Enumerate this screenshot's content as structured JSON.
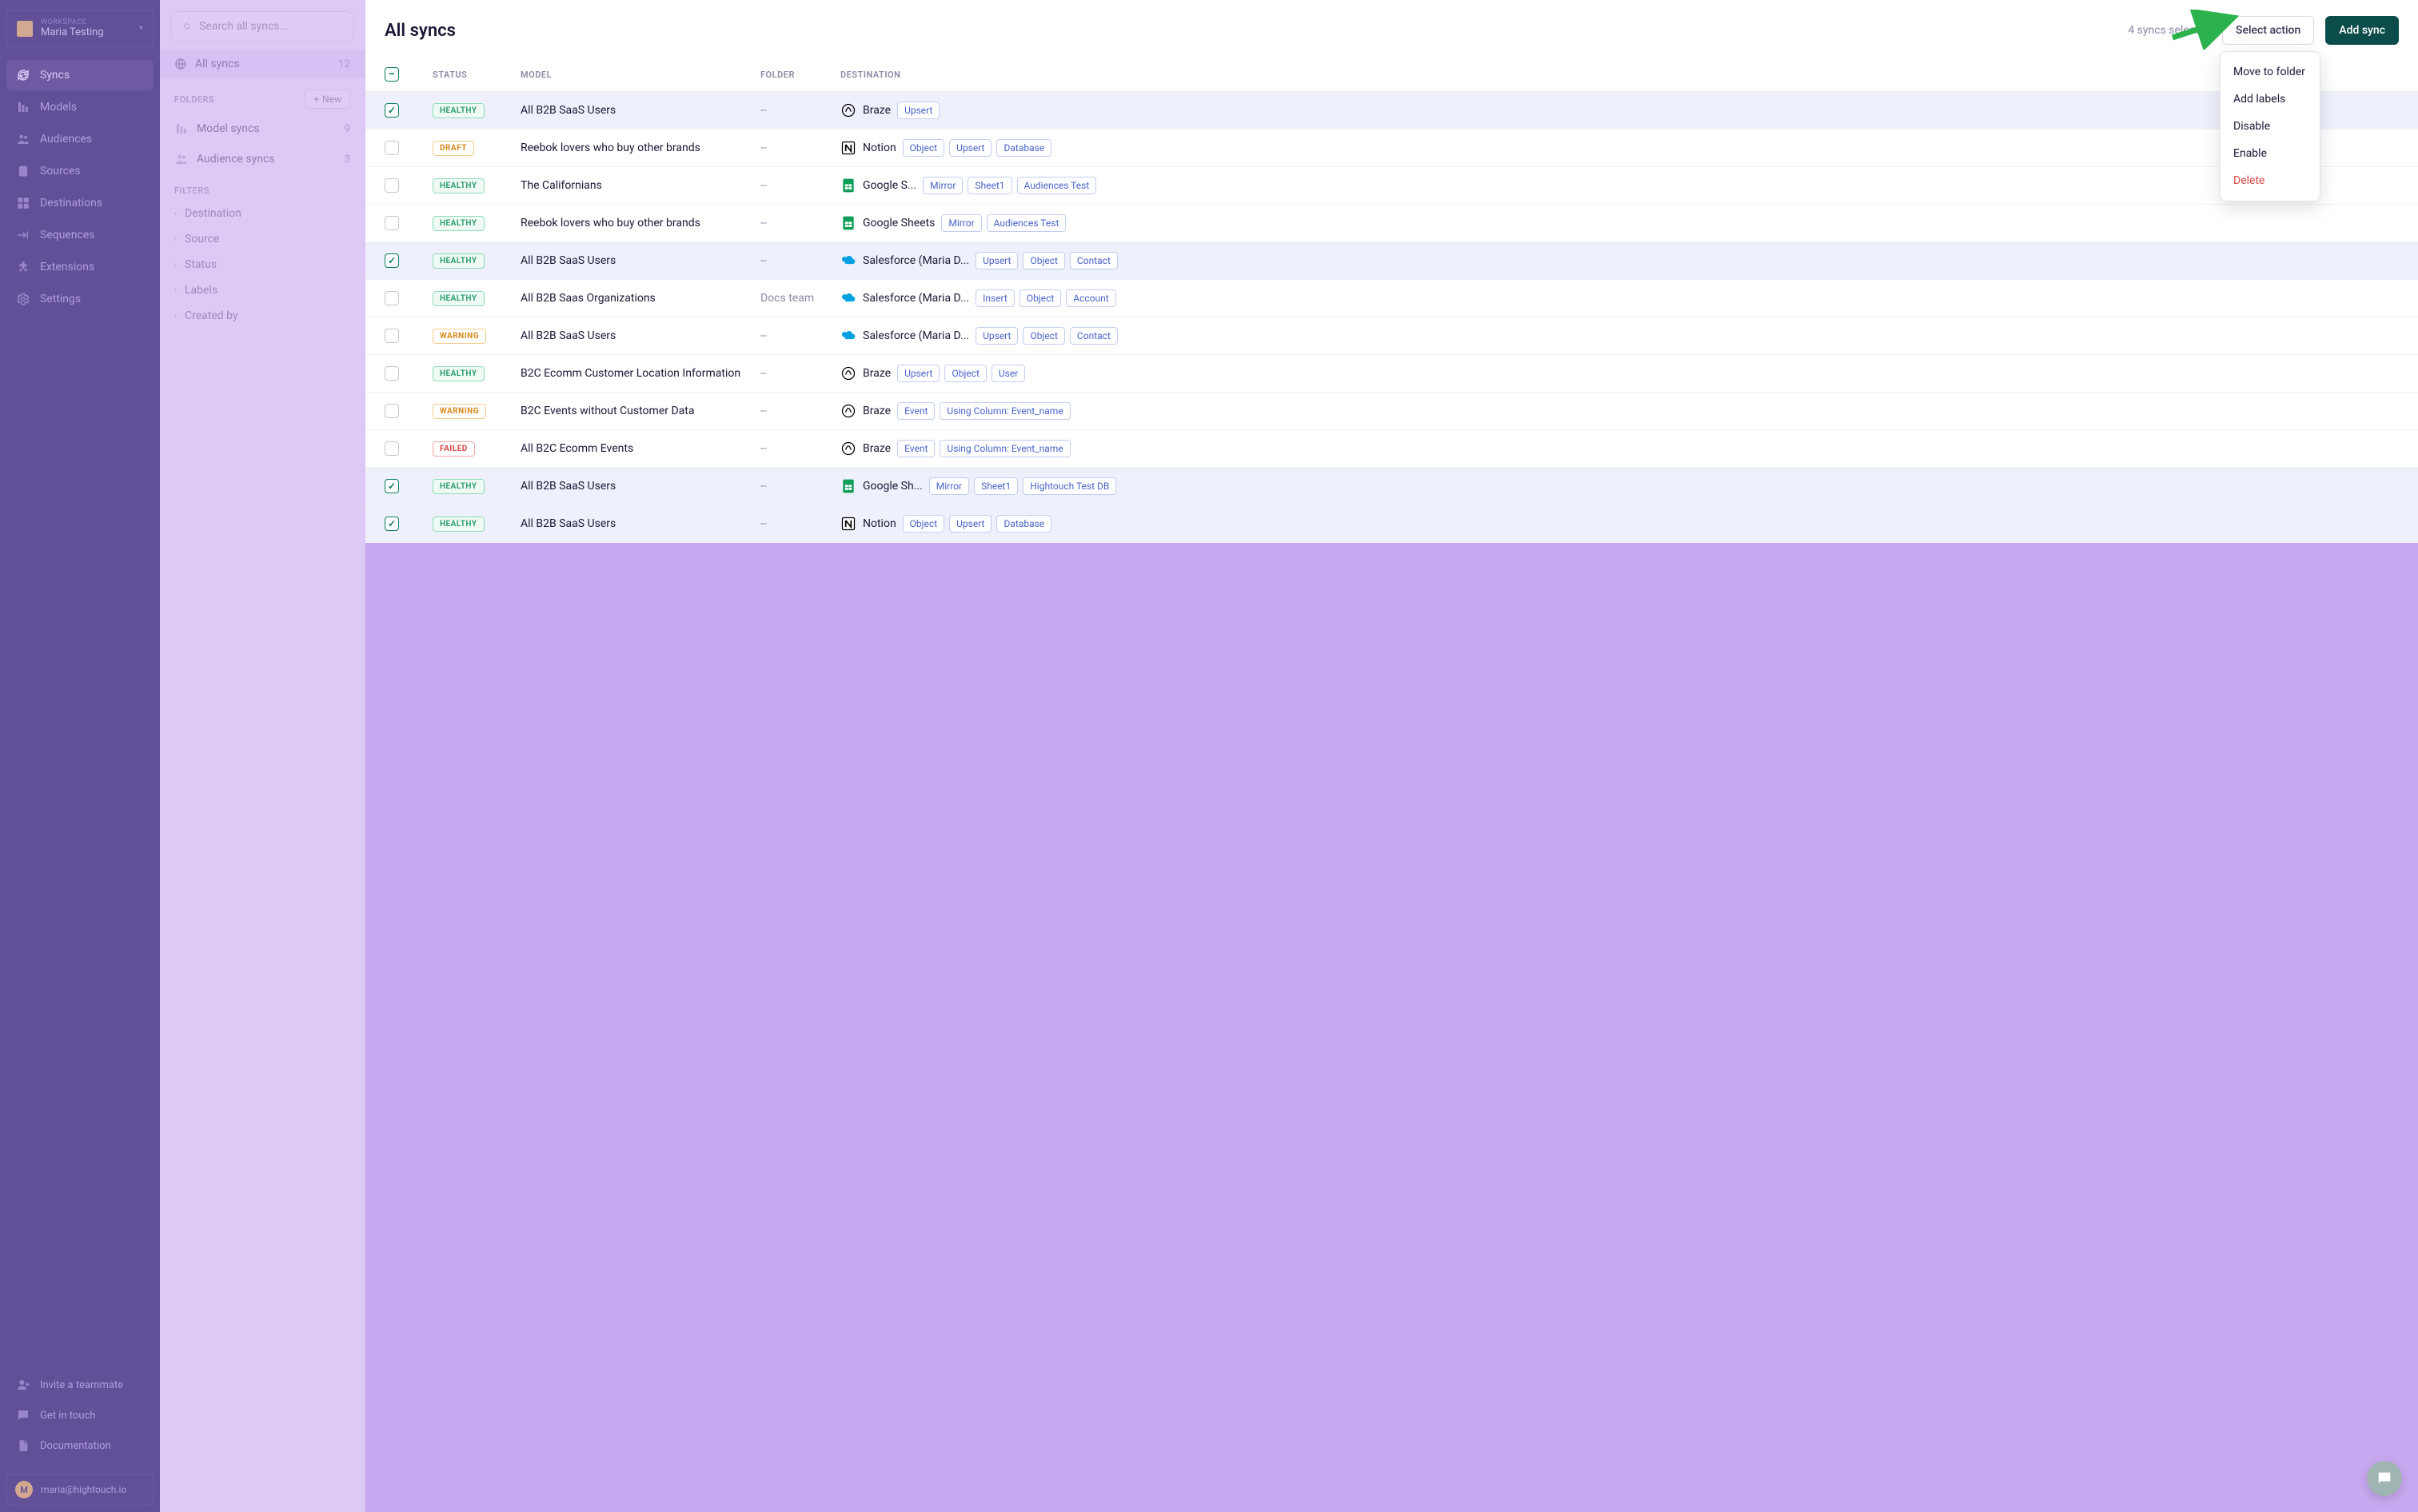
{
  "workspace": {
    "label": "WORKSPACE",
    "name": "Maria Testing"
  },
  "nav": [
    {
      "label": "Syncs",
      "icon": "syncs",
      "active": true
    },
    {
      "label": "Models",
      "icon": "models"
    },
    {
      "label": "Audiences",
      "icon": "audiences"
    },
    {
      "label": "Sources",
      "icon": "sources"
    },
    {
      "label": "Destinations",
      "icon": "destinations"
    },
    {
      "label": "Sequences",
      "icon": "sequences"
    },
    {
      "label": "Extensions",
      "icon": "extensions"
    },
    {
      "label": "Settings",
      "icon": "settings"
    }
  ],
  "footer_nav": [
    {
      "label": "Invite a teammate",
      "icon": "invite"
    },
    {
      "label": "Get in touch",
      "icon": "chat"
    },
    {
      "label": "Documentation",
      "icon": "docs"
    }
  ],
  "user": {
    "initial": "M",
    "email": "maria@hightouch.io"
  },
  "search": {
    "placeholder": "Search all syncs..."
  },
  "mid_panel": {
    "all_syncs_label": "All syncs",
    "all_syncs_count": "12",
    "folders_heading": "FOLDERS",
    "new_button": "New",
    "folders": [
      {
        "label": "Model syncs",
        "count": "9",
        "icon": "models"
      },
      {
        "label": "Audience syncs",
        "count": "3",
        "icon": "audiences"
      }
    ],
    "filters_heading": "FILTERS",
    "filters": [
      {
        "label": "Destination"
      },
      {
        "label": "Source"
      },
      {
        "label": "Status"
      },
      {
        "label": "Labels"
      },
      {
        "label": "Created by"
      }
    ]
  },
  "page": {
    "title": "All syncs",
    "selected_text": "4 syncs selected",
    "select_action": "Select action",
    "add_sync": "Add sync"
  },
  "dropdown": [
    {
      "label": "Move to folder"
    },
    {
      "label": "Add labels"
    },
    {
      "label": "Disable"
    },
    {
      "label": "Enable"
    },
    {
      "label": "Delete",
      "danger": true
    }
  ],
  "table": {
    "columns": {
      "status": "STATUS",
      "model": "MODEL",
      "folder": "FOLDER",
      "destination": "DESTINATION"
    },
    "rows": [
      {
        "checked": true,
        "status": "HEALTHY",
        "model": "All B2B SaaS Users",
        "folder": "--",
        "dest_icon": "braze",
        "dest": "Braze",
        "tags": [
          "Upsert"
        ]
      },
      {
        "checked": false,
        "status": "DRAFT",
        "model": "Reebok lovers who buy other brands",
        "folder": "--",
        "dest_icon": "notion",
        "dest": "Notion",
        "tags": [
          "Object",
          "Upsert",
          "Database"
        ]
      },
      {
        "checked": false,
        "status": "HEALTHY",
        "model": "The Californians",
        "folder": "--",
        "dest_icon": "gsheets",
        "dest": "Google S...",
        "tags": [
          "Mirror",
          "Sheet1",
          "Audiences Test"
        ]
      },
      {
        "checked": false,
        "status": "HEALTHY",
        "model": "Reebok lovers who buy other brands",
        "folder": "--",
        "dest_icon": "gsheets",
        "dest": "Google Sheets",
        "tags": [
          "Mirror",
          "Audiences Test"
        ]
      },
      {
        "checked": true,
        "status": "HEALTHY",
        "model": "All B2B SaaS Users",
        "folder": "--",
        "dest_icon": "salesforce",
        "dest": "Salesforce (Maria D...",
        "tags": [
          "Upsert",
          "Object",
          "Contact"
        ]
      },
      {
        "checked": false,
        "status": "HEALTHY",
        "model": "All B2B Saas Organizations",
        "folder": "Docs team",
        "dest_icon": "salesforce",
        "dest": "Salesforce (Maria D...",
        "tags": [
          "Insert",
          "Object",
          "Account"
        ]
      },
      {
        "checked": false,
        "status": "WARNING",
        "model": "All B2B SaaS Users",
        "folder": "--",
        "dest_icon": "salesforce",
        "dest": "Salesforce (Maria D...",
        "tags": [
          "Upsert",
          "Object",
          "Contact"
        ]
      },
      {
        "checked": false,
        "status": "HEALTHY",
        "model": "B2C Ecomm Customer Location Information",
        "folder": "--",
        "dest_icon": "braze",
        "dest": "Braze",
        "tags": [
          "Upsert",
          "Object",
          "User"
        ]
      },
      {
        "checked": false,
        "status": "WARNING",
        "model": "B2C Events without Customer Data",
        "folder": "--",
        "dest_icon": "braze",
        "dest": "Braze",
        "tags": [
          "Event",
          "Using Column: Event_name"
        ]
      },
      {
        "checked": false,
        "status": "FAILED",
        "model": "All B2C Ecomm Events",
        "folder": "--",
        "dest_icon": "braze",
        "dest": "Braze",
        "tags": [
          "Event",
          "Using Column: Event_name"
        ]
      },
      {
        "checked": true,
        "status": "HEALTHY",
        "model": "All B2B SaaS Users",
        "folder": "--",
        "dest_icon": "gsheets",
        "dest": "Google Sh...",
        "tags": [
          "Mirror",
          "Sheet1",
          "Hightouch Test DB"
        ]
      },
      {
        "checked": true,
        "status": "HEALTHY",
        "model": "All B2B SaaS Users",
        "folder": "--",
        "dest_icon": "notion",
        "dest": "Notion",
        "tags": [
          "Object",
          "Upsert",
          "Database"
        ]
      }
    ]
  }
}
